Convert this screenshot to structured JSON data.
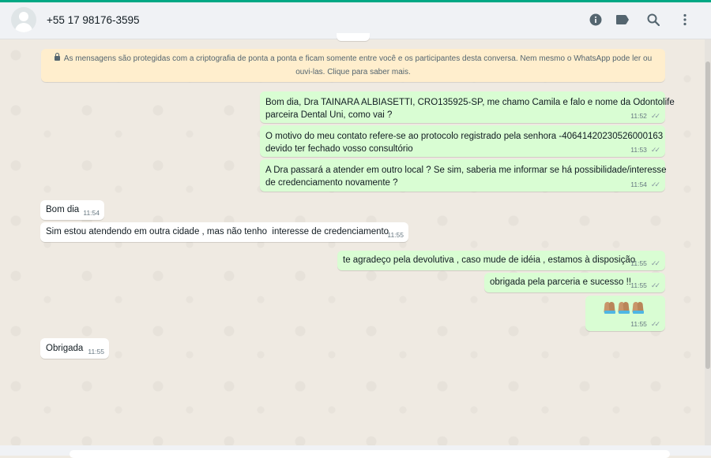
{
  "header": {
    "contact": "+55 17 98176-3595",
    "icons": [
      "info-icon",
      "label-icon",
      "search-icon",
      "menu-icon"
    ]
  },
  "notice": {
    "text": "As mensagens são protegidas com a criptografia de ponta a ponta e ficam somente entre você e os participantes desta conversa. Nem mesmo o WhatsApp pode ler ou ouvi-las. Clique para saber mais."
  },
  "messages": [
    {
      "direction": "out",
      "text": "Bom dia, Dra TAINARA ALBIASETTI, CRO135925-SP, me chamo Camila e falo e nome da Odontolife\nparceira Dental Uni, como vai ?",
      "time": "11:52"
    },
    {
      "direction": "out",
      "text": "O motivo do meu contato refere-se ao protocolo registrado pela senhora -40641420230526000163\ndevido ter fechado vosso consultório",
      "time": "11:53"
    },
    {
      "direction": "out",
      "text": "A Dra passará a atender em outro local ? Se sim, saberia me informar se há possibilidade/interesse\nde credenciamento novamente ?",
      "time": "11:54"
    },
    {
      "direction": "in",
      "text": "Bom dia",
      "time": "11:54"
    },
    {
      "direction": "in",
      "text": "Sim estou atendendo em outra cidade , mas não tenho  interesse de credenciamento",
      "time": "11:55"
    },
    {
      "direction": "out",
      "text": "te agradeço pela devolutiva , caso mude de idéia , estamos à disposição",
      "time": "11:55"
    },
    {
      "direction": "out",
      "text": "obrigada pela parceria e sucesso !!",
      "time": "11:55"
    },
    {
      "direction": "out",
      "text": "🙏🏽🙏🏽🙏🏽",
      "time": "11:55"
    },
    {
      "direction": "in",
      "text": "Obrigada",
      "time": "11:55"
    }
  ],
  "colors": {
    "accent": "#00a884",
    "outgoing": "#d9fdd3",
    "incoming": "#ffffff",
    "notice": "#ffeecd"
  }
}
